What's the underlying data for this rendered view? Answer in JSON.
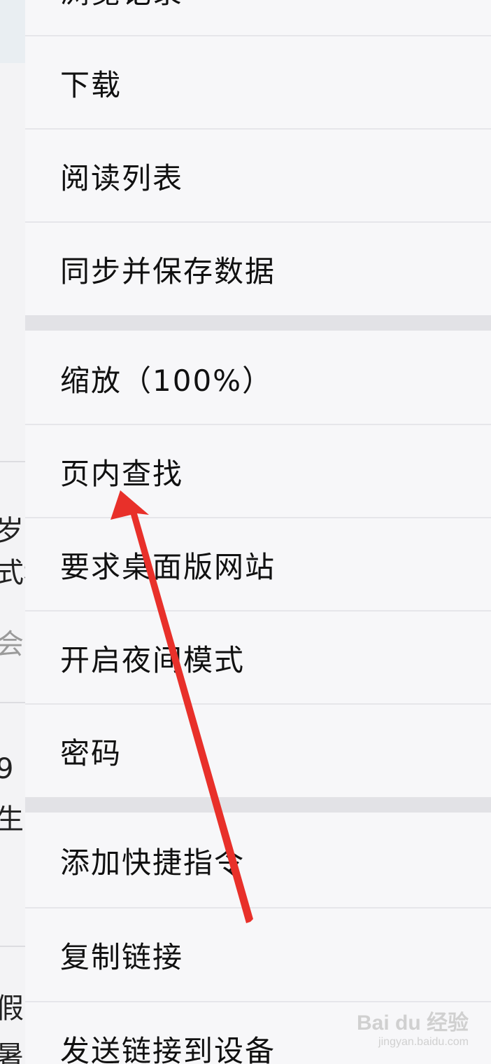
{
  "background_page": {
    "fragments": [
      "岁队",
      "式科",
      "会",
      "9",
      "生",
      "假",
      "暑"
    ]
  },
  "menu": {
    "partial_top_item": "浏览记录",
    "group1": [
      "下载",
      "阅读列表",
      "同步并保存数据"
    ],
    "group2": [
      "缩放（100%）",
      "页内查找",
      "要求桌面版网站",
      "开启夜间模式",
      "密码"
    ],
    "group3": [
      "添加快捷指令",
      "复制链接",
      "发送链接到设备"
    ]
  },
  "annotation": {
    "arrow_color": "#e8302a",
    "points_to": "页内查找"
  },
  "watermark": {
    "main": "Bai du 经验",
    "sub": "jingyan.baidu.com"
  }
}
